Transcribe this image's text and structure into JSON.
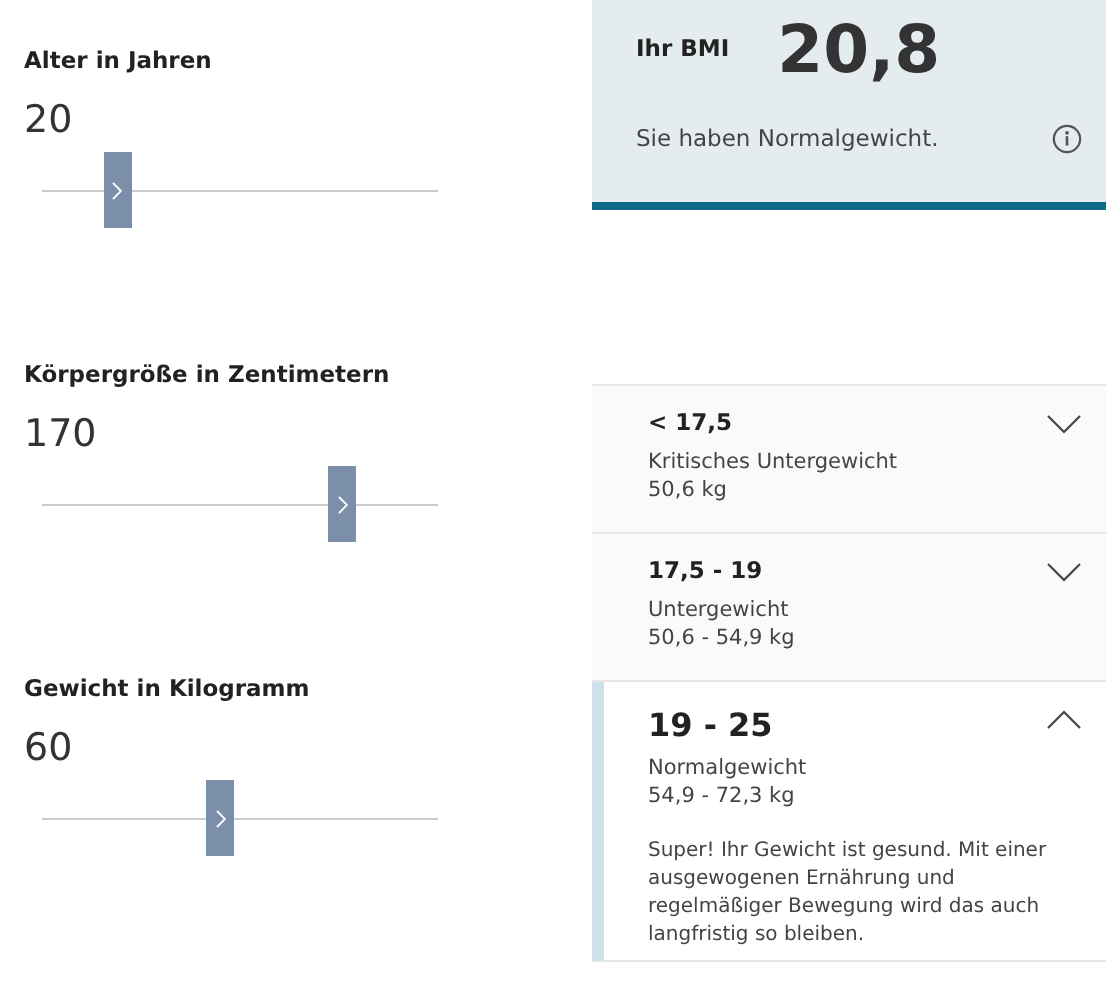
{
  "inputs": [
    {
      "label": "Alter in Jahren",
      "value": "20",
      "level": 0.19
    },
    {
      "label": "Körpergröße in Zentimetern",
      "value": "170",
      "level": 0.76
    },
    {
      "label": "Gewicht in Kilogramm",
      "value": "60",
      "level": 0.45
    }
  ],
  "result": {
    "label": "Ihr BMI",
    "value": "20,8",
    "message": "Sie haben Normalgewicht."
  },
  "categories": [
    {
      "range": "< 17,5",
      "name": "Kritisches Untergewicht",
      "weight": "50,6 kg",
      "expanded": false
    },
    {
      "range": "17,5 - 19",
      "name": "Untergewicht",
      "weight": "50,6 - 54,9 kg",
      "expanded": false
    },
    {
      "range": "19 - 25",
      "name": "Normalgewicht",
      "weight": "54,9 - 72,3 kg",
      "expanded": true,
      "description": "Super! Ihr Gewicht ist gesund. Mit einer ausgewogenen Ernährung und regelmäßiger Bewegung wird das auch langfristig so bleiben."
    }
  ]
}
